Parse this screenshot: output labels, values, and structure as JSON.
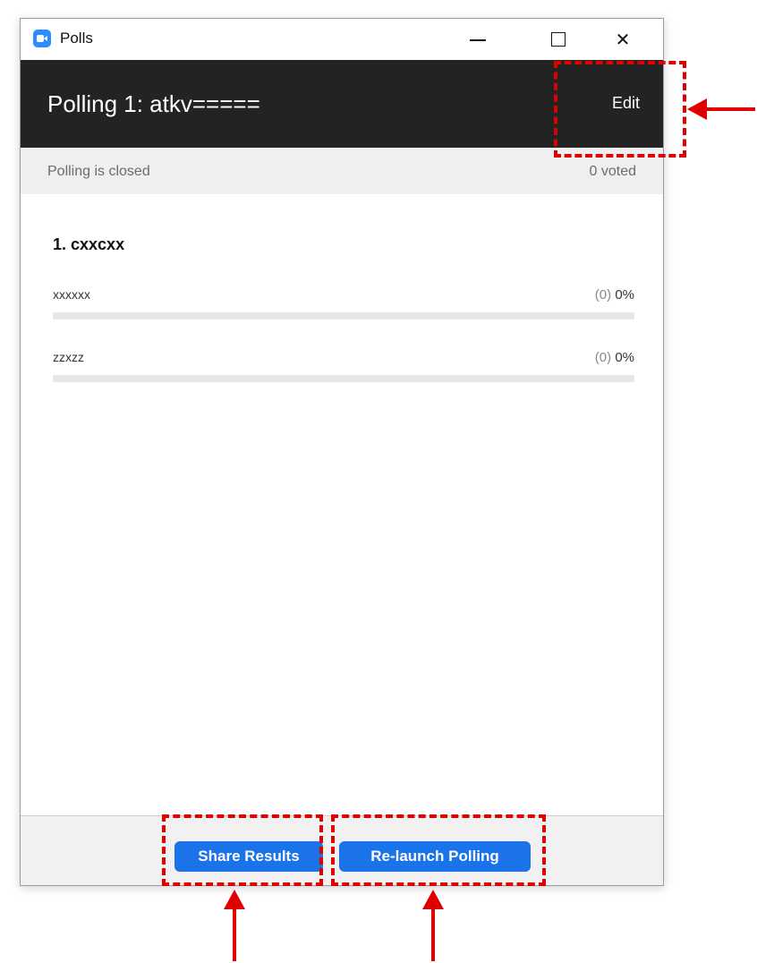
{
  "window": {
    "title": "Polls",
    "controls": {
      "minimize": "minimize-icon",
      "maximize": "maximize-icon",
      "close": "close-icon"
    }
  },
  "header": {
    "title": "Polling 1: atkv=====",
    "edit_label": "Edit"
  },
  "status": {
    "text": "Polling is closed",
    "voted": "0 voted"
  },
  "question": {
    "title": "1. cxxcxx",
    "options": [
      {
        "label": "xxxxxx",
        "count": "(0)",
        "percent": "0%",
        "fill": 0
      },
      {
        "label": "zzxzz",
        "count": "(0)",
        "percent": "0%",
        "fill": 0
      }
    ]
  },
  "footer": {
    "share_label": "Share Results",
    "relaunch_label": "Re-launch Polling"
  },
  "colors": {
    "accent": "#1a73e8",
    "header_bg": "#232323",
    "annotation": "#e00000"
  }
}
